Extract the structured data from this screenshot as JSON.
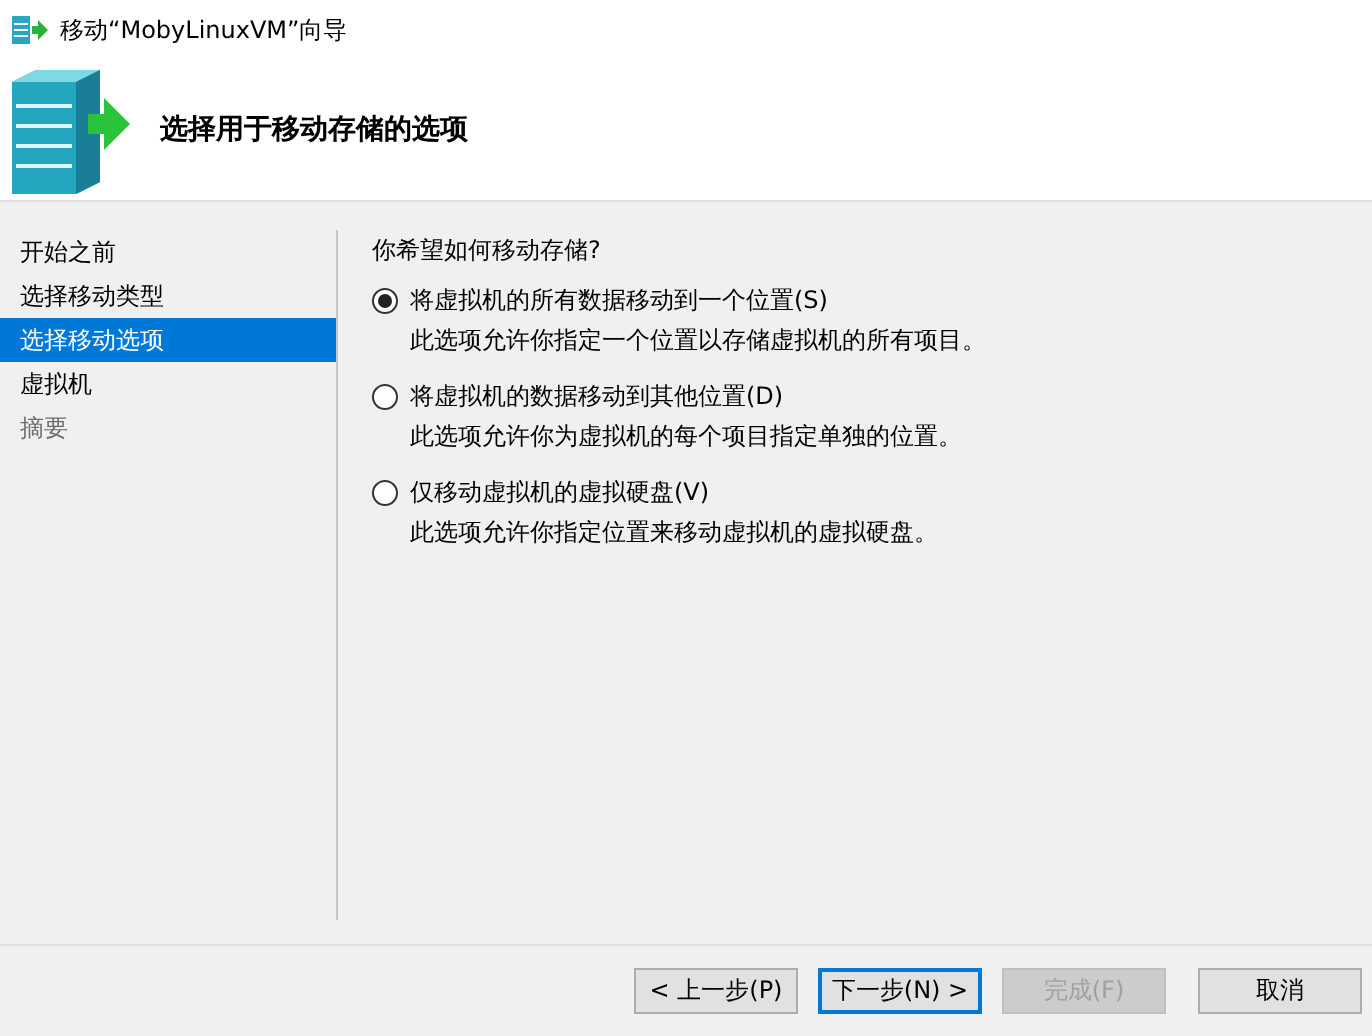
{
  "window": {
    "title": "移动“MobyLinuxVM”向导"
  },
  "header": {
    "title": "选择用于移动存储的选项"
  },
  "sidebar": {
    "items": [
      {
        "label": "开始之前",
        "selected": false,
        "disabled": false
      },
      {
        "label": "选择移动类型",
        "selected": false,
        "disabled": false
      },
      {
        "label": "选择移动选项",
        "selected": true,
        "disabled": false
      },
      {
        "label": "虚拟机",
        "selected": false,
        "disabled": false
      },
      {
        "label": "摘要",
        "selected": false,
        "disabled": true
      }
    ]
  },
  "question": "你希望如何移动存储?",
  "options": [
    {
      "label": "将虚拟机的所有数据移动到一个位置(S)",
      "description": "此选项允许你指定一个位置以存储虚拟机的所有项目。",
      "selected": true
    },
    {
      "label": "将虚拟机的数据移动到其他位置(D)",
      "description": "此选项允许你为虚拟机的每个项目指定单独的位置。",
      "selected": false
    },
    {
      "label": "仅移动虚拟机的虚拟硬盘(V)",
      "description": "此选项允许你指定位置来移动虚拟机的虚拟硬盘。",
      "selected": false
    }
  ],
  "buttons": [
    {
      "label": "< 上一步(P)",
      "default": false,
      "disabled": false
    },
    {
      "label": "下一步(N) >",
      "default": true,
      "disabled": false
    },
    {
      "label": "完成(F)",
      "default": false,
      "disabled": true
    },
    {
      "label": "取消",
      "default": false,
      "disabled": false
    }
  ]
}
